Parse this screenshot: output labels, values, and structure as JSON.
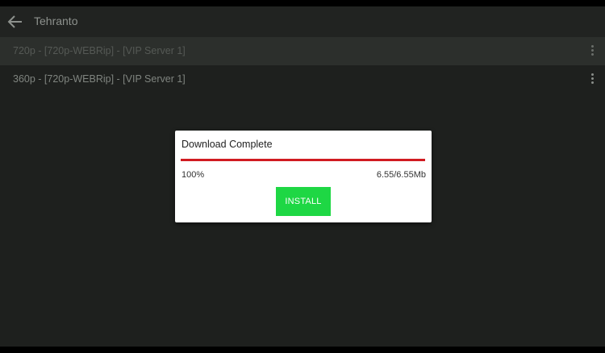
{
  "app": {
    "title": "Tehranto"
  },
  "list": {
    "items": [
      {
        "label": "720p - [720p-WEBRip] - [VIP Server 1]"
      },
      {
        "label": "360p - [720p-WEBRip] - [VIP Server 1]"
      }
    ]
  },
  "dialog": {
    "title": "Download Complete",
    "percent_text": "100%",
    "size_text": "6.55/6.55Mb",
    "progress": 1.0,
    "install_label": "INSTALL"
  },
  "colors": {
    "progress": "#d11b21",
    "install_button": "#1ed744"
  },
  "icons": {
    "back": "arrow-left-icon",
    "more": "more-vertical-icon"
  }
}
